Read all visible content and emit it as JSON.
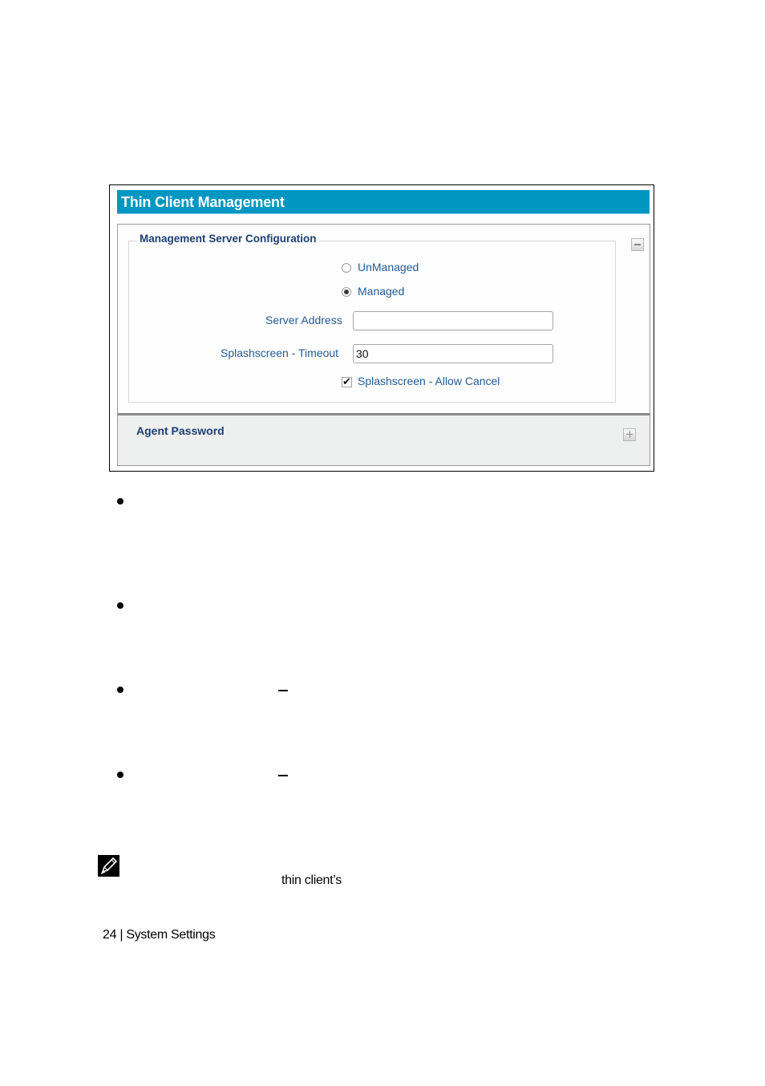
{
  "window": {
    "title": "Thin Client Management"
  },
  "management_server": {
    "section_title": "Management Server Configuration",
    "collapse_icon": "minus-icon",
    "mode_options": [
      {
        "label": "UnManaged",
        "selected": false
      },
      {
        "label": "Managed",
        "selected": true
      }
    ],
    "server_address": {
      "label": "Server Address",
      "value": ""
    },
    "splash_timeout": {
      "label": "Splashscreen - Timeout",
      "value": "30"
    },
    "allow_cancel": {
      "label": "Splashscreen - Allow Cancel",
      "checked": true
    }
  },
  "agent_password": {
    "section_title": "Agent Password",
    "expand_icon": "plus-icon"
  },
  "document": {
    "bullet_count": 4,
    "note_icon": "pencil-note-icon",
    "note_fragment": "thin client’s",
    "footer": "24 | System Settings"
  }
}
